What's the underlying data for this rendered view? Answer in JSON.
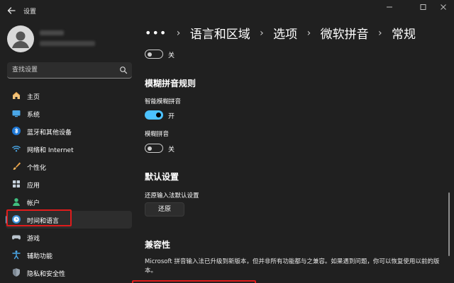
{
  "window": {
    "title": "设置"
  },
  "search": {
    "placeholder": "查找设置"
  },
  "sidebar": {
    "items": [
      {
        "label": "主页",
        "icon": "home-icon"
      },
      {
        "label": "系统",
        "icon": "system-icon"
      },
      {
        "label": "蓝牙和其他设备",
        "icon": "bluetooth-icon"
      },
      {
        "label": "网络和 Internet",
        "icon": "wifi-icon"
      },
      {
        "label": "个性化",
        "icon": "brush-icon"
      },
      {
        "label": "应用",
        "icon": "apps-icon"
      },
      {
        "label": "帐户",
        "icon": "account-icon"
      },
      {
        "label": "时间和语言",
        "icon": "time-language-icon",
        "selected": true
      },
      {
        "label": "游戏",
        "icon": "gamepad-icon"
      },
      {
        "label": "辅助功能",
        "icon": "accessibility-icon"
      },
      {
        "label": "隐私和安全性",
        "icon": "shield-icon"
      }
    ]
  },
  "breadcrumb": {
    "more": "•••",
    "items": [
      "语言和区域",
      "选项",
      "微软拼音",
      "常规"
    ]
  },
  "content": {
    "top_toggle": {
      "state_label": "关",
      "on": false
    },
    "fuzzy_section": {
      "heading": "模糊拼音规则",
      "smart_label": "智能模糊拼音",
      "smart_state": "开",
      "smart_on": true,
      "fuzzy_label": "模糊拼音",
      "fuzzy_state": "关",
      "fuzzy_on": false
    },
    "default_section": {
      "heading": "默认设置",
      "restore_label": "还原输入法默认设置",
      "restore_button": "还原"
    },
    "compat_section": {
      "heading": "兼容性",
      "description": "Microsoft 拼音输入法已升级到新版本，但并非所有功能都与之兼容。如果遇到问题，你可以恢复使用以前的版本。"
    }
  },
  "colors": {
    "background": "#202020",
    "accent": "#4cc2ff",
    "selected_indicator": "#60cdff",
    "highlight_box": "#e01b1b"
  }
}
